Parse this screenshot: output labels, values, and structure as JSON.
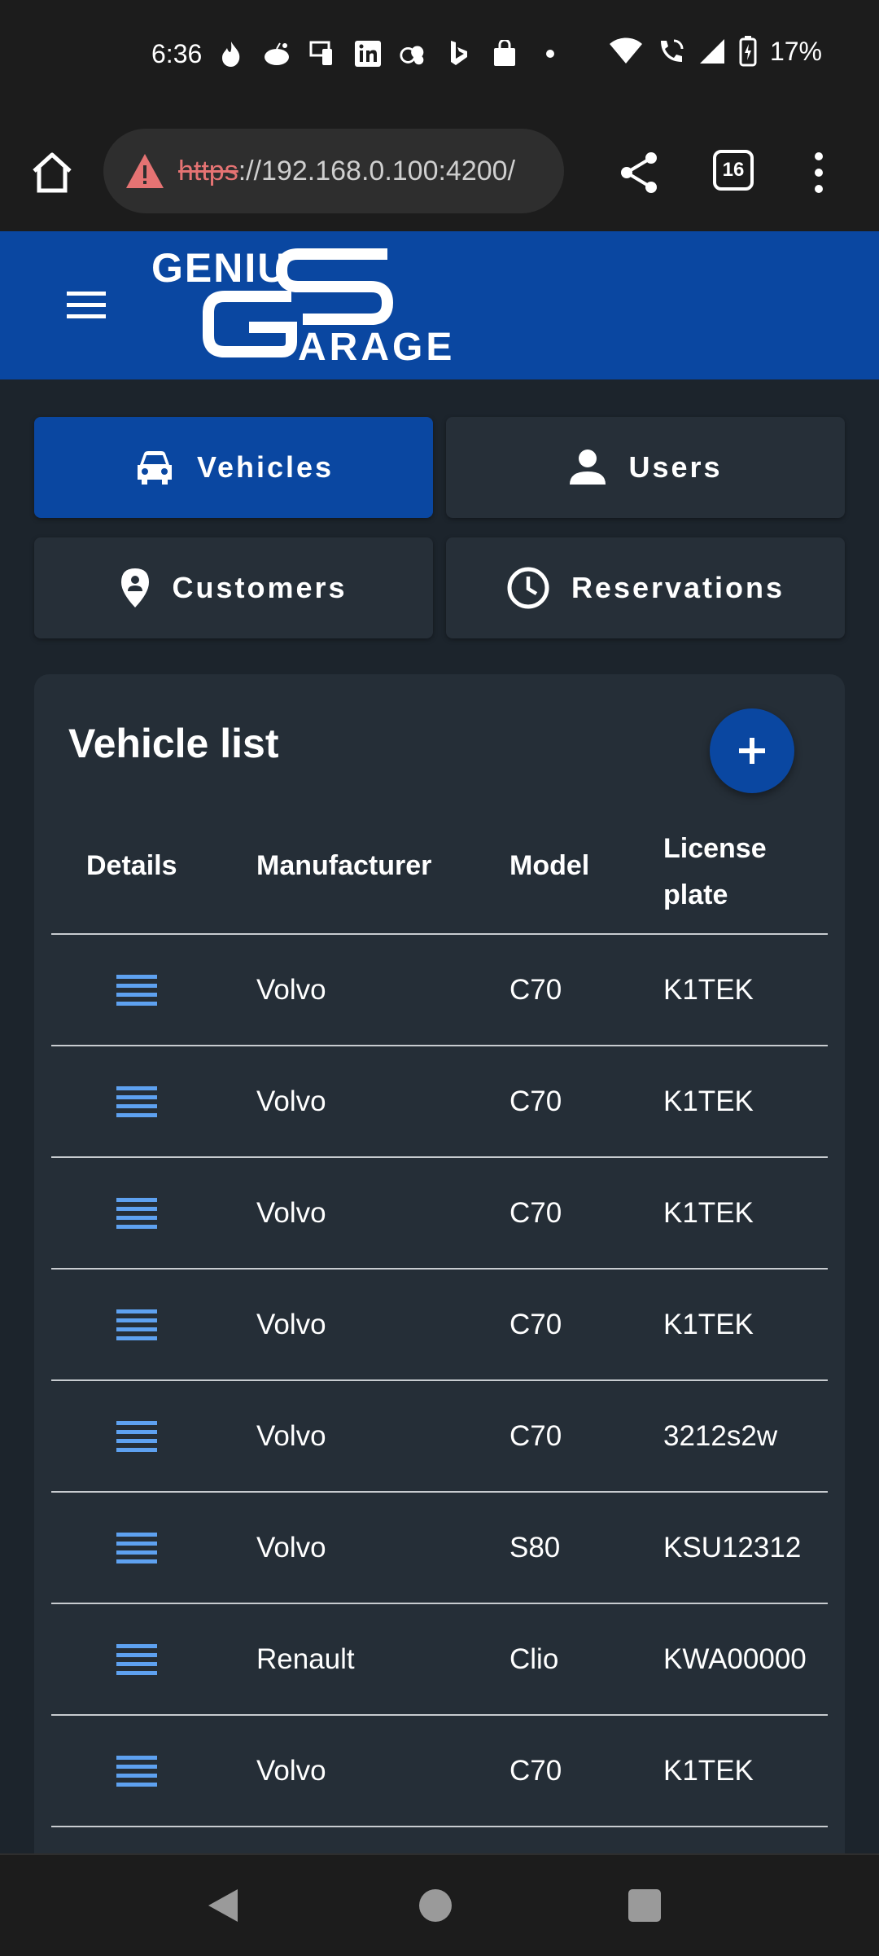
{
  "status_bar": {
    "time": "6:36",
    "battery": "17%",
    "notification_icons": [
      "tinder-icon",
      "reddit-icon",
      "phone-link-icon",
      "linkedin-icon",
      "cloud-icon",
      "bing-icon",
      "shopping-bag-icon",
      "dot-icon"
    ]
  },
  "browser": {
    "url_scheme": "https",
    "url_rest": "://192.168.0.100:4200/",
    "tab_count": "16"
  },
  "app": {
    "logo_alt": "Genius Garage"
  },
  "nav": {
    "vehicles": "Vehicles",
    "users": "Users",
    "customers": "Customers",
    "reservations": "Reservations"
  },
  "vehicle_list": {
    "title": "Vehicle list",
    "columns": {
      "details": "Details",
      "manufacturer": "Manufacturer",
      "model": "Model",
      "license_plate": "License plate"
    },
    "rows": [
      {
        "manufacturer": "Volvo",
        "model": "C70",
        "plate": "K1TEK"
      },
      {
        "manufacturer": "Volvo",
        "model": "C70",
        "plate": "K1TEK"
      },
      {
        "manufacturer": "Volvo",
        "model": "C70",
        "plate": "K1TEK"
      },
      {
        "manufacturer": "Volvo",
        "model": "C70",
        "plate": "K1TEK"
      },
      {
        "manufacturer": "Volvo",
        "model": "C70",
        "plate": "3212s2w"
      },
      {
        "manufacturer": "Volvo",
        "model": "S80",
        "plate": "KSU12312"
      },
      {
        "manufacturer": "Renault",
        "model": "Clio",
        "plate": "KWA00000"
      },
      {
        "manufacturer": "Volvo",
        "model": "C70",
        "plate": "K1TEK"
      }
    ]
  },
  "colors": {
    "brand_blue": "#0a47a1",
    "details_icon": "#5ea1f0",
    "card_bg": "#252e37",
    "page_bg": "#1c242c",
    "warning": "#e57373"
  }
}
